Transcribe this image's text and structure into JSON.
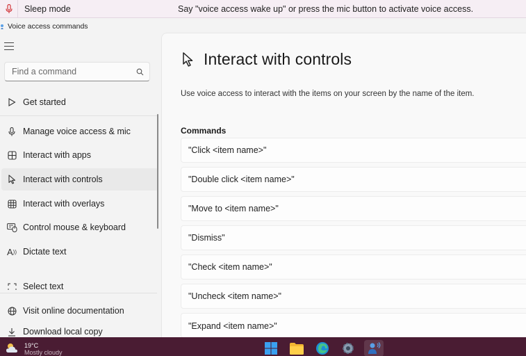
{
  "voice_bar": {
    "mode": "Sleep mode",
    "hint": "Say \"voice access wake up\" or press the mic button to activate voice access."
  },
  "window": {
    "title": "Voice access commands"
  },
  "sidebar": {
    "search_placeholder": "Find a command",
    "items": [
      {
        "label": "Get started",
        "icon": "play-outline-icon"
      },
      {
        "label": "Manage voice access & mic",
        "icon": "microphone-icon"
      },
      {
        "label": "Interact with apps",
        "icon": "apps-icon"
      },
      {
        "label": "Interact with controls",
        "icon": "cursor-icon"
      },
      {
        "label": "Interact with overlays",
        "icon": "grid-icon"
      },
      {
        "label": "Control mouse & keyboard",
        "icon": "mouse-keyboard-icon"
      },
      {
        "label": "Dictate text",
        "icon": "dictate-icon"
      },
      {
        "label": "Select text",
        "icon": "select-text-icon"
      }
    ],
    "footer": [
      {
        "label": "Visit online documentation",
        "icon": "globe-icon"
      },
      {
        "label": "Download local copy",
        "icon": "download-icon"
      }
    ]
  },
  "main": {
    "title": "Interact with controls",
    "description": "Use voice access to interact with the items on your screen by the name of the item.",
    "section_label": "Commands",
    "commands": [
      "\"Click <item name>\"",
      "\"Double click <item name>\"",
      "\"Move to <item name>\"",
      "\"Dismiss\"",
      "\"Check <item name>\"",
      "\"Uncheck <item name>\"",
      "\"Expand <item name>\""
    ]
  },
  "taskbar": {
    "temperature": "19°C",
    "condition": "Mostly cloudy",
    "apps": [
      "windows-start-icon",
      "file-explorer-icon",
      "edge-icon",
      "settings-icon",
      "voice-access-icon"
    ]
  },
  "colors": {
    "taskbar_bg": "#4a1c33",
    "voice_bar_bg": "#f6eef4",
    "mic_red": "#d13438",
    "active_item_bg": "#e9e9e9"
  }
}
